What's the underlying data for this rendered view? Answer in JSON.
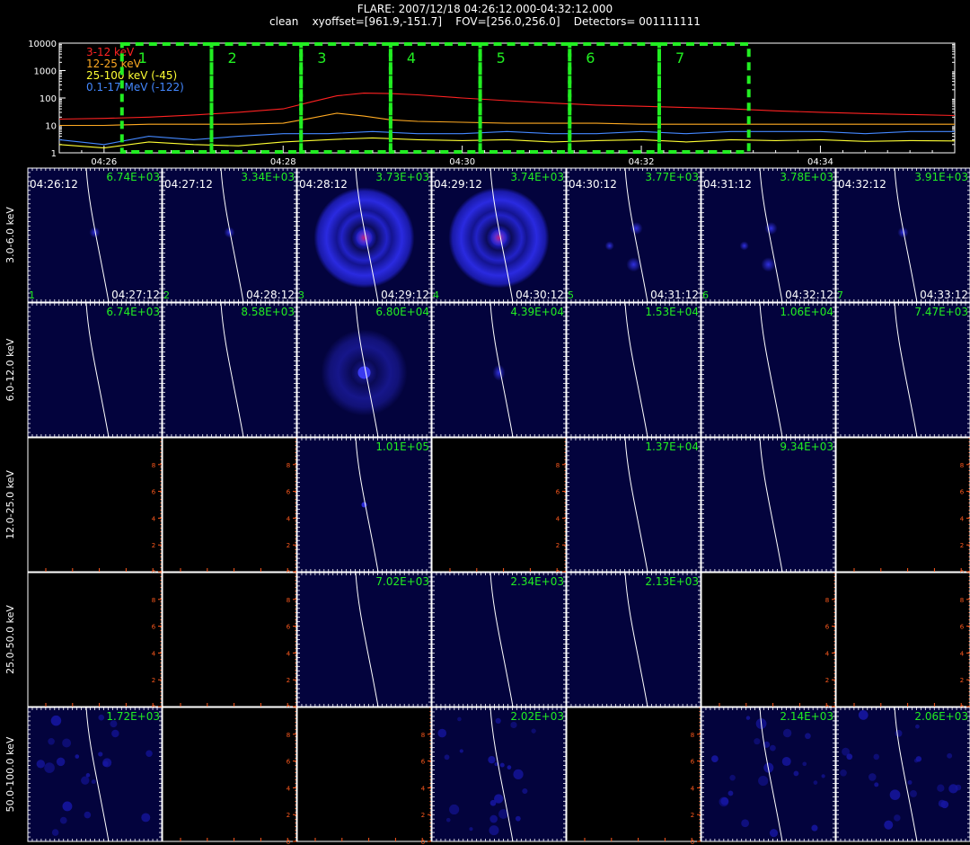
{
  "header": {
    "line1": "FLARE: 2007/12/18 04:26:12.000-04:32:12.000",
    "line2": "clean    xyoffset=[961.9,-151.7]    FOV=[256.0,256.0]    Detectors= 001111111"
  },
  "colors": {
    "bg": "#000000",
    "panel": "#03033d",
    "box": "#22ee22",
    "limb": "#ffffff",
    "empty_axis": "#ff5a1e",
    "peak_text": "#22ee22"
  },
  "chart_data": [
    {
      "type": "line",
      "name": "lightcurve",
      "ylog": true,
      "ylim": [
        1,
        10000
      ],
      "xlim_min": [
        25.5,
        35.5
      ],
      "ytick_labels": [
        "1",
        "10",
        "100",
        "1000",
        "10000"
      ],
      "ytick_values": [
        1,
        10,
        100,
        1000,
        10000
      ],
      "xtick_labels": [
        "04:26",
        "04:28",
        "04:30",
        "04:32",
        "04:34"
      ],
      "xtick_values": [
        26,
        28,
        30,
        32,
        34
      ],
      "legend_position": "top-left",
      "series": [
        {
          "name": "3-12 keV",
          "color": "#ff2222",
          "x": [
            25.5,
            26.0,
            26.5,
            27.0,
            27.5,
            28.0,
            28.3,
            28.6,
            28.9,
            29.2,
            29.5,
            30.0,
            30.5,
            31.0,
            31.5,
            32.0,
            32.5,
            33.0,
            33.5,
            34.0,
            34.5,
            35.0,
            35.5
          ],
          "y": [
            17,
            18,
            20,
            24,
            30,
            40,
            70,
            120,
            150,
            145,
            130,
            100,
            80,
            65,
            55,
            50,
            45,
            40,
            34,
            30,
            27,
            25,
            23
          ]
        },
        {
          "name": "12-25 keV",
          "color": "#ffaa22",
          "x": [
            25.5,
            26.0,
            26.5,
            27.0,
            27.5,
            28.0,
            28.3,
            28.6,
            28.9,
            29.2,
            29.5,
            30.0,
            30.5,
            31.0,
            31.5,
            32.0,
            32.5,
            33.0,
            33.5,
            34.0,
            34.5,
            35.0,
            35.5
          ],
          "y": [
            10,
            10,
            11,
            11,
            11,
            12,
            18,
            28,
            22,
            16,
            14,
            13,
            12,
            12,
            12,
            11,
            11,
            11,
            11,
            11,
            11,
            11,
            11
          ]
        },
        {
          "name": "25-100 keV (-45)",
          "color": "#ffff33",
          "x": [
            25.5,
            26.0,
            26.5,
            27.0,
            27.5,
            28.0,
            28.5,
            29.0,
            29.5,
            30.0,
            30.5,
            31.0,
            31.5,
            32.0,
            32.5,
            33.0,
            33.5,
            34.0,
            34.5,
            35.0,
            35.5
          ],
          "y": [
            2,
            1.5,
            2.5,
            2,
            1.8,
            2.5,
            3,
            3.5,
            3,
            2.8,
            3,
            2.5,
            2.8,
            3,
            2.5,
            3,
            2.8,
            3,
            2.6,
            2.8,
            2.7
          ]
        },
        {
          "name": "0.1-17 MeV (-122)",
          "color": "#4488ff",
          "x": [
            25.5,
            26.0,
            26.5,
            27.0,
            27.5,
            28.0,
            28.5,
            29.0,
            29.5,
            30.0,
            30.5,
            31.0,
            31.5,
            32.0,
            32.5,
            33.0,
            33.5,
            34.0,
            34.5,
            35.0,
            35.5
          ],
          "y": [
            3,
            2,
            4,
            3,
            4,
            5,
            5,
            6,
            5,
            5,
            6,
            5,
            5,
            6,
            5,
            6,
            6,
            6,
            5,
            6,
            6
          ]
        }
      ],
      "intervals": [
        {
          "label": "1",
          "x0": 26.2,
          "x1": 27.2
        },
        {
          "label": "2",
          "x0": 27.2,
          "x1": 28.2
        },
        {
          "label": "3",
          "x0": 28.2,
          "x1": 29.2
        },
        {
          "label": "4",
          "x0": 29.2,
          "x1": 30.2
        },
        {
          "label": "5",
          "x0": 30.2,
          "x1": 31.2
        },
        {
          "label": "6",
          "x0": 31.2,
          "x1": 32.2
        },
        {
          "label": "7",
          "x0": 32.2,
          "x1": 33.2
        }
      ]
    },
    {
      "type": "heatmap",
      "name": "image-grid",
      "rows": [
        "3.0-6.0 keV",
        "6.0-12.0 keV",
        "12.0-25.0 keV",
        "25.0-50.0 keV",
        "50.0-100.0 keV"
      ],
      "columns": [
        {
          "start": "04:26:12",
          "end": "04:27:12",
          "index": "1"
        },
        {
          "start": "04:27:12",
          "end": "04:28:12",
          "index": "2"
        },
        {
          "start": "04:28:12",
          "end": "04:29:12",
          "index": "3"
        },
        {
          "start": "04:29:12",
          "end": "04:30:12",
          "index": "4"
        },
        {
          "start": "04:30:12",
          "end": "04:31:12",
          "index": "5"
        },
        {
          "start": "04:31:12",
          "end": "04:32:12",
          "index": "6"
        },
        {
          "start": "04:32:12",
          "end": "04:33:12",
          "index": "7"
        }
      ],
      "empty_axis_ticks": [
        "0",
        "2",
        "4",
        "6",
        "8"
      ],
      "cells": [
        [
          "6.74E+03",
          "3.34E+03",
          "3.73E+03",
          "3.74E+03",
          "3.77E+03",
          "3.78E+03",
          "3.91E+03"
        ],
        [
          "6.74E+03",
          "8.58E+03",
          "6.80E+04",
          "4.39E+04",
          "1.53E+04",
          "1.06E+04",
          "7.47E+03"
        ],
        [
          null,
          null,
          "1.01E+05",
          null,
          "1.37E+04",
          "9.34E+03",
          null
        ],
        [
          null,
          null,
          "7.02E+03",
          "2.34E+03",
          "2.13E+03",
          null,
          null
        ],
        [
          "1.72E+03",
          null,
          null,
          "2.02E+03",
          null,
          "2.14E+03",
          "2.06E+03"
        ]
      ],
      "sources": [
        [
          "faint",
          "faint",
          "rings",
          "rings",
          "multi",
          "multi",
          "faint"
        ],
        [
          "none",
          "none",
          "ring",
          "point",
          "none",
          "none",
          "none"
        ],
        [
          null,
          null,
          "tiny",
          null,
          "none",
          "none",
          null
        ],
        [
          null,
          null,
          "none",
          "none",
          "none",
          null,
          null
        ],
        [
          "noise",
          null,
          null,
          "noise",
          null,
          "noise",
          "noise"
        ]
      ]
    }
  ]
}
